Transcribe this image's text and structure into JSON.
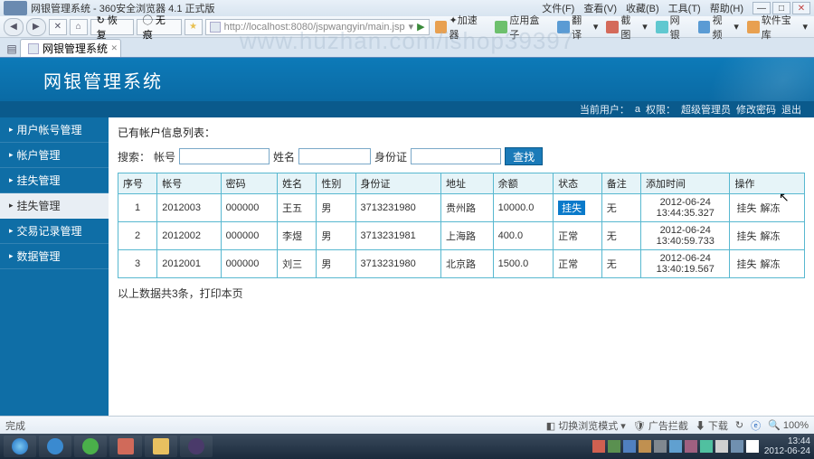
{
  "browser": {
    "title": "网银管理系统 - 360安全浏览器 4.1 正式版",
    "menus": [
      "文件(F)",
      "查看(V)",
      "收藏(B)",
      "工具(T)",
      "帮助(H)"
    ],
    "refresh_label": "↻ 恢复",
    "wuhen_label": "◯ 无痕",
    "url": "http://localhost:8080/jspwangyin/main.jsp",
    "toolbar_right": [
      "✦加速器",
      "应用盒子",
      "翻译",
      "截图",
      "网银",
      "视频",
      "软件宝库"
    ],
    "tab_label": "网银管理系统",
    "status_left": "完成",
    "status_mode": "切换浏览模式",
    "status_items": [
      "广告拦截",
      "下载",
      "↻"
    ],
    "zoom": "🔍 100%"
  },
  "app": {
    "title": "网银管理系统",
    "user_label": "当前用户：",
    "user": "a",
    "role_label": "权限：",
    "role": "超级管理员",
    "change_pwd": "修改密码",
    "logout": "退出"
  },
  "sidebar": {
    "items": [
      {
        "label": "用户帐号管理"
      },
      {
        "label": "帐户管理"
      },
      {
        "label": "挂失管理"
      },
      {
        "label": "挂失管理"
      },
      {
        "label": "交易记录管理"
      },
      {
        "label": "数据管理"
      }
    ],
    "active_index": 3
  },
  "content": {
    "info_title": "已有帐户信息列表：",
    "search": {
      "prefix": "搜索：",
      "acct_label": "帐号",
      "name_label": "姓名",
      "id_label": "身份证",
      "btn": "查找"
    },
    "columns": [
      "序号",
      "帐号",
      "密码",
      "姓名",
      "性别",
      "身份证",
      "地址",
      "余额",
      "状态",
      "备注",
      "添加时间",
      "操作"
    ],
    "rows": [
      {
        "idx": "1",
        "acct": "2012003",
        "pwd": "000000",
        "name": "王五",
        "gender": "男",
        "idcard": "3713231980",
        "addr": "贵州路",
        "balance": "10000.0",
        "status": "挂失",
        "status_lost": true,
        "remark": "无",
        "time": "2012-06-24 13:44:35.327"
      },
      {
        "idx": "2",
        "acct": "2012002",
        "pwd": "000000",
        "name": "李煜",
        "gender": "男",
        "idcard": "3713231981",
        "addr": "上海路",
        "balance": "400.0",
        "status": "正常",
        "status_lost": false,
        "remark": "无",
        "time": "2012-06-24 13:40:59.733"
      },
      {
        "idx": "3",
        "acct": "2012001",
        "pwd": "000000",
        "name": "刘三",
        "gender": "男",
        "idcard": "3713231980",
        "addr": "北京路",
        "balance": "1500.0",
        "status": "正常",
        "status_lost": false,
        "remark": "无",
        "time": "2012-06-24 13:40:19.567"
      }
    ],
    "op_lost": "挂失",
    "op_unfreeze": "解冻",
    "summary": "以上数据共3条，打印本页"
  },
  "system": {
    "time": "13:44",
    "date": "2012-06-24"
  },
  "watermark": "www.huzhan.com/ishop39397"
}
